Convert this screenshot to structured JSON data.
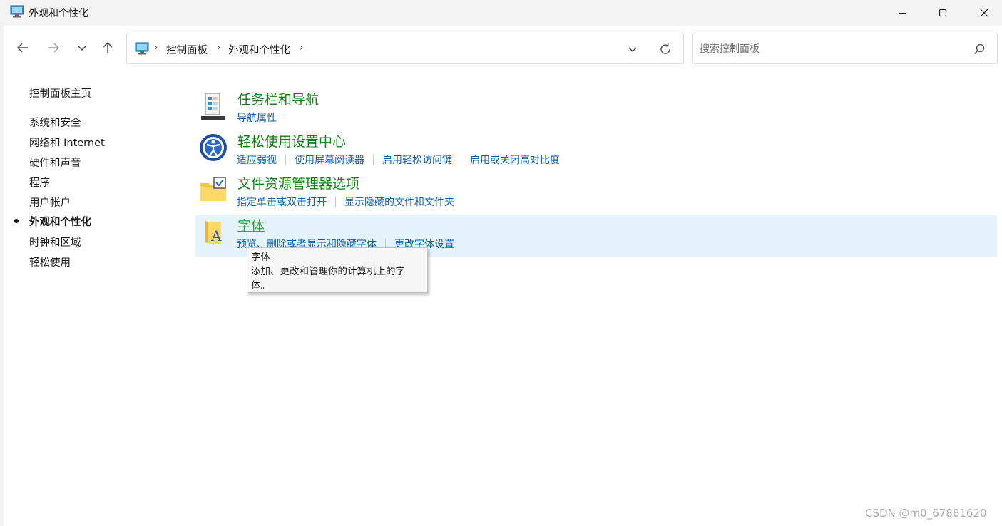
{
  "window": {
    "title": "外观和个性化",
    "app_icon": "control-panel-icon",
    "controls": [
      "minimize-icon",
      "maximize-icon",
      "close-icon"
    ]
  },
  "toolbar": {
    "back": "arrow-left-icon",
    "forward": "arrow-right-icon",
    "recent": "chevron-down-icon",
    "up": "arrow-up-icon"
  },
  "address": {
    "icon": "control-panel-icon",
    "crumbs": [
      "控制面板",
      "外观和个性化"
    ],
    "dropdown": "chevron-down-icon",
    "refresh": "refresh-icon"
  },
  "search": {
    "placeholder": "搜索控制面板",
    "icon": "search-icon"
  },
  "sidebar": {
    "home": "控制面板主页",
    "items": [
      {
        "label": "系统和安全",
        "active": false
      },
      {
        "label": "网络和 Internet",
        "active": false
      },
      {
        "label": "硬件和声音",
        "active": false
      },
      {
        "label": "程序",
        "active": false
      },
      {
        "label": "用户帐户",
        "active": false
      },
      {
        "label": "外观和个性化",
        "active": true
      },
      {
        "label": "时钟和区域",
        "active": false
      },
      {
        "label": "轻松使用",
        "active": false
      }
    ]
  },
  "categories": [
    {
      "title": "任务栏和导航",
      "icon": "taskbar-icon",
      "links": [
        "导航属性"
      ]
    },
    {
      "title": "轻松使用设置中心",
      "icon": "ease-of-access-icon",
      "links": [
        "适应弱视",
        "使用屏幕阅读器",
        "启用轻松访问键",
        "启用或关闭高对比度"
      ]
    },
    {
      "title": "文件资源管理器选项",
      "icon": "folder-options-icon",
      "links": [
        "指定单击或双击打开",
        "显示隐藏的文件和文件夹"
      ]
    },
    {
      "title": "字体",
      "icon": "fonts-folder-icon",
      "links": [
        "预览、删除或者显示和隐藏字体",
        "更改字体设置"
      ],
      "hovered": true
    }
  ],
  "tooltip": {
    "title": "字体",
    "body": "添加、更改和管理你的计算机上的字体。"
  },
  "watermark": "CSDN @m0_67881620",
  "colors": {
    "category_title": "#157d1a",
    "link": "#0a5fa8",
    "hover_bg": "#e5f3fd",
    "titlebar_bg": "#f3f3f3"
  }
}
